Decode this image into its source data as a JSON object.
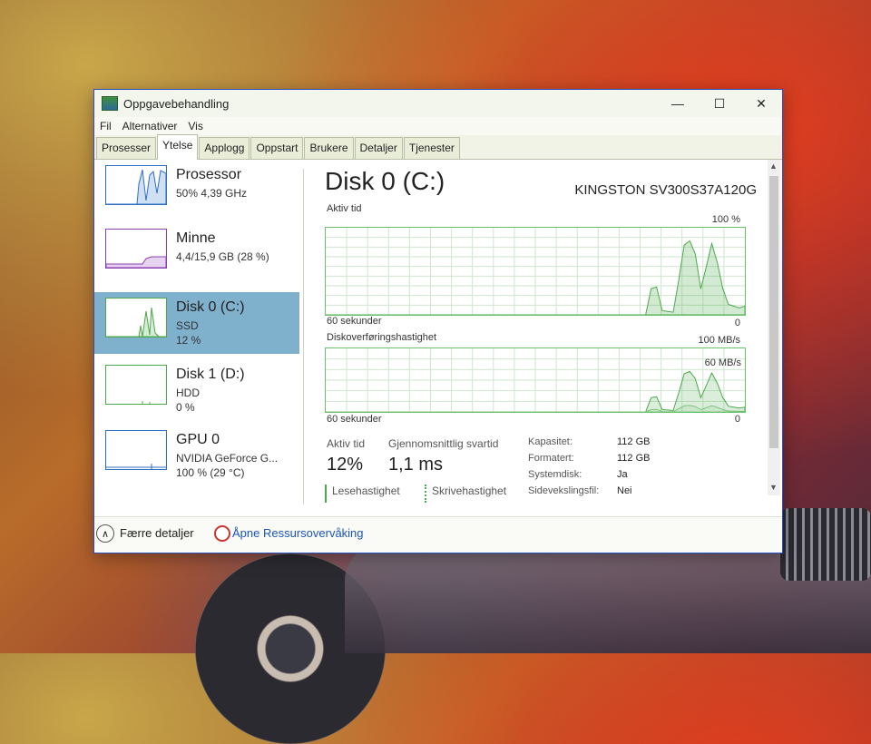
{
  "window": {
    "title": "Oppgavebehandling",
    "min": "—",
    "max": "☐",
    "close": "✕"
  },
  "menu": [
    "Fil",
    "Alternativer",
    "Vis"
  ],
  "tabs": [
    "Prosesser",
    "Ytelse",
    "Applogg",
    "Oppstart",
    "Brukere",
    "Detaljer",
    "Tjenester"
  ],
  "active_tab": "Ytelse",
  "sidebar": [
    {
      "name": "Prosessor",
      "line1": "50% 4,39 GHz",
      "line2": "",
      "color": "#2f6fc0"
    },
    {
      "name": "Minne",
      "line1": "4,4/15,9 GB (28 %)",
      "line2": "",
      "color": "#8a3fb0"
    },
    {
      "name": "Disk 0 (C:)",
      "line1": "SSD",
      "line2": "12 %",
      "color": "#4da84d"
    },
    {
      "name": "Disk 1 (D:)",
      "line1": "HDD",
      "line2": "0 %",
      "color": "#4da84d"
    },
    {
      "name": "GPU 0",
      "line1": "NVIDIA GeForce G...",
      "line2": "100 % (29 °C)",
      "color": "#2f6fc0"
    }
  ],
  "detail": {
    "title": "Disk 0 (C:)",
    "model": "KINGSTON SV300S37A120G",
    "graph1": {
      "label": "Aktiv tid",
      "max": "100 %",
      "time": "60 sekunder",
      "min": "0"
    },
    "graph2": {
      "label": "Diskoverføringshastighet",
      "max": "100 MB/s",
      "mid": "60 MB/s",
      "time": "60 sekunder",
      "min": "0"
    },
    "stats": {
      "active_label": "Aktiv tid",
      "active_value": "12%",
      "resp_label": "Gjennomsnittlig svartid",
      "resp_value": "1,1 ms",
      "read_label": "Lesehastighet",
      "write_label": "Skrivehastighet"
    },
    "props": [
      {
        "k": "Kapasitet:",
        "v": "112 GB"
      },
      {
        "k": "Formatert:",
        "v": "112 GB"
      },
      {
        "k": "Systemdisk:",
        "v": "Ja"
      },
      {
        "k": "Sidevekslingsfil:",
        "v": "Nei"
      }
    ]
  },
  "footer": {
    "less_details": "Færre detaljer",
    "resmon": "Åpne Ressursovervåking"
  },
  "chart_data": {
    "type": "area",
    "series": [
      {
        "name": "Aktiv tid",
        "unit": "%",
        "values": [
          0,
          0,
          0,
          0,
          0,
          0,
          0,
          0,
          0,
          0,
          0,
          0,
          0,
          0,
          0,
          0,
          0,
          0,
          0,
          0,
          0,
          0,
          0,
          0,
          0,
          0,
          0,
          0,
          0,
          0,
          0,
          0,
          0,
          0,
          0,
          0,
          0,
          0,
          0,
          0,
          0,
          0,
          0,
          0,
          0,
          0,
          0,
          0,
          0,
          0,
          0,
          0,
          0,
          0,
          0,
          0,
          0,
          0,
          0,
          30,
          32,
          5,
          4,
          3,
          40,
          80,
          85,
          70,
          30,
          55,
          82,
          60,
          30,
          12,
          10,
          8,
          10
        ]
      }
    ],
    "ylim": [
      0,
      100
    ]
  }
}
